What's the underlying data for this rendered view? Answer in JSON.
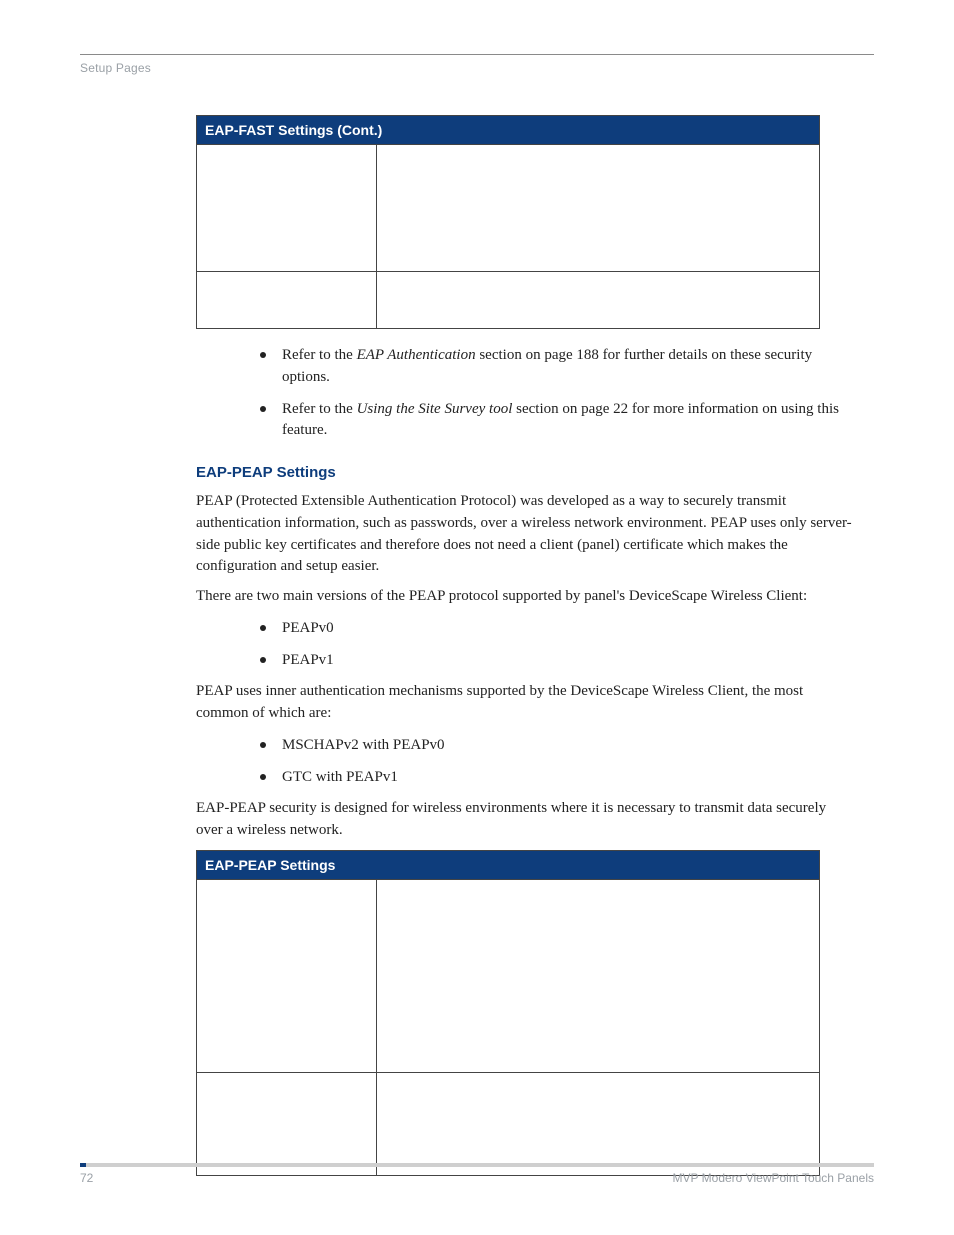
{
  "header": {
    "section": "Setup Pages"
  },
  "tables": {
    "eap_fast_title": "EAP-FAST Settings (Cont.)",
    "eap_peap_title": "EAP-PEAP Settings"
  },
  "refs": {
    "item1": {
      "pre": "Refer to the ",
      "em": "EAP Authentication",
      "post": " section on page 188 for further details on these security options."
    },
    "item2": {
      "pre": "Refer to the ",
      "em": "Using the Site Survey tool",
      "post": " section on page 22 for more information on using this feature."
    }
  },
  "section": {
    "title": "EAP-PEAP Settings",
    "p1": "PEAP (Protected Extensible Authentication Protocol) was developed as a way to securely transmit authentication information, such as passwords, over a wireless network environment. PEAP uses only server-side public key certificates and therefore does not need a client (panel) certificate which makes the configuration and setup easier.",
    "p2": "There are two main versions of the PEAP protocol supported by panel's DeviceScape Wireless Client:",
    "list1": [
      "PEAPv0",
      "PEAPv1"
    ],
    "p3": "PEAP uses inner authentication mechanisms supported by the DeviceScape Wireless Client, the most common of which are:",
    "list2": [
      "MSCHAPv2 with PEAPv0",
      "GTC with PEAPv1"
    ],
    "p4": "EAP-PEAP security is designed for wireless environments where it is necessary to transmit data securely over a wireless network."
  },
  "footer": {
    "page": "72",
    "doc": "MVP Modero ViewPoint Touch Panels"
  }
}
